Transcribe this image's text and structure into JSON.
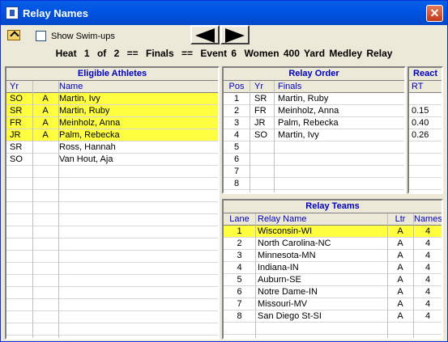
{
  "window": {
    "title": "Relay Names",
    "close_glyph": "✕"
  },
  "toolbar": {
    "show_swimups_label": "Show Swim-ups",
    "show_swimups_checked": false
  },
  "heat": {
    "heat_word": "Heat",
    "heat_num": "1",
    "of_word": "of",
    "heat_total": "2",
    "sep1": "==",
    "round": "Finals",
    "sep2": "==",
    "event": "Event 6",
    "event_name": "Women 400 Yard Medley Relay"
  },
  "eligible": {
    "title": "Eligible Athletes",
    "headers": [
      "Yr",
      "",
      "Name"
    ],
    "rows": [
      {
        "yr": "SO",
        "ltr": "A",
        "name": "Martin, Ivy",
        "selected": true
      },
      {
        "yr": "SR",
        "ltr": "A",
        "name": "Martin, Ruby",
        "selected": true
      },
      {
        "yr": "FR",
        "ltr": "A",
        "name": "Meinholz, Anna",
        "selected": true
      },
      {
        "yr": "JR",
        "ltr": "A",
        "name": "Palm, Rebecka",
        "selected": true
      },
      {
        "yr": "SR",
        "ltr": "",
        "name": "Ross, Hannah",
        "selected": false
      },
      {
        "yr": "SO",
        "ltr": "",
        "name": "Van Hout, Aja",
        "selected": false
      }
    ]
  },
  "order": {
    "title": "Relay Order",
    "headers": [
      "Pos",
      "Yr",
      "Finals"
    ],
    "rows": [
      {
        "pos": "1",
        "yr": "SR",
        "name": "Martin, Ruby"
      },
      {
        "pos": "2",
        "yr": "FR",
        "name": "Meinholz, Anna"
      },
      {
        "pos": "3",
        "yr": "JR",
        "name": "Palm, Rebecka"
      },
      {
        "pos": "4",
        "yr": "SO",
        "name": "Martin, Ivy"
      },
      {
        "pos": "5",
        "yr": "",
        "name": ""
      },
      {
        "pos": "6",
        "yr": "",
        "name": ""
      },
      {
        "pos": "7",
        "yr": "",
        "name": ""
      },
      {
        "pos": "8",
        "yr": "",
        "name": ""
      }
    ]
  },
  "react": {
    "title": "React",
    "header": "RT",
    "values": [
      "",
      "0.15",
      "0.40",
      "0.26",
      "",
      "",
      "",
      ""
    ]
  },
  "teams": {
    "title": "Relay Teams",
    "headers": [
      "Lane",
      "Relay Name",
      "Ltr",
      "Names"
    ],
    "rows": [
      {
        "lane": "1",
        "name": "Wisconsin-WI",
        "ltr": "A",
        "names": "4",
        "selected": true
      },
      {
        "lane": "2",
        "name": "North Carolina-NC",
        "ltr": "A",
        "names": "4",
        "selected": false
      },
      {
        "lane": "3",
        "name": "Minnesota-MN",
        "ltr": "A",
        "names": "4",
        "selected": false
      },
      {
        "lane": "4",
        "name": "Indiana-IN",
        "ltr": "A",
        "names": "4",
        "selected": false
      },
      {
        "lane": "5",
        "name": "Auburn-SE",
        "ltr": "A",
        "names": "4",
        "selected": false
      },
      {
        "lane": "6",
        "name": "Notre Dame-IN",
        "ltr": "A",
        "names": "4",
        "selected": false
      },
      {
        "lane": "7",
        "name": "Missouri-MV",
        "ltr": "A",
        "names": "4",
        "selected": false
      },
      {
        "lane": "8",
        "name": "San Diego St-SI",
        "ltr": "A",
        "names": "4",
        "selected": false
      }
    ]
  },
  "colors": {
    "selected_row": "#ffff40",
    "header_text": "#0000c0",
    "title_bar": "#0054e3"
  }
}
